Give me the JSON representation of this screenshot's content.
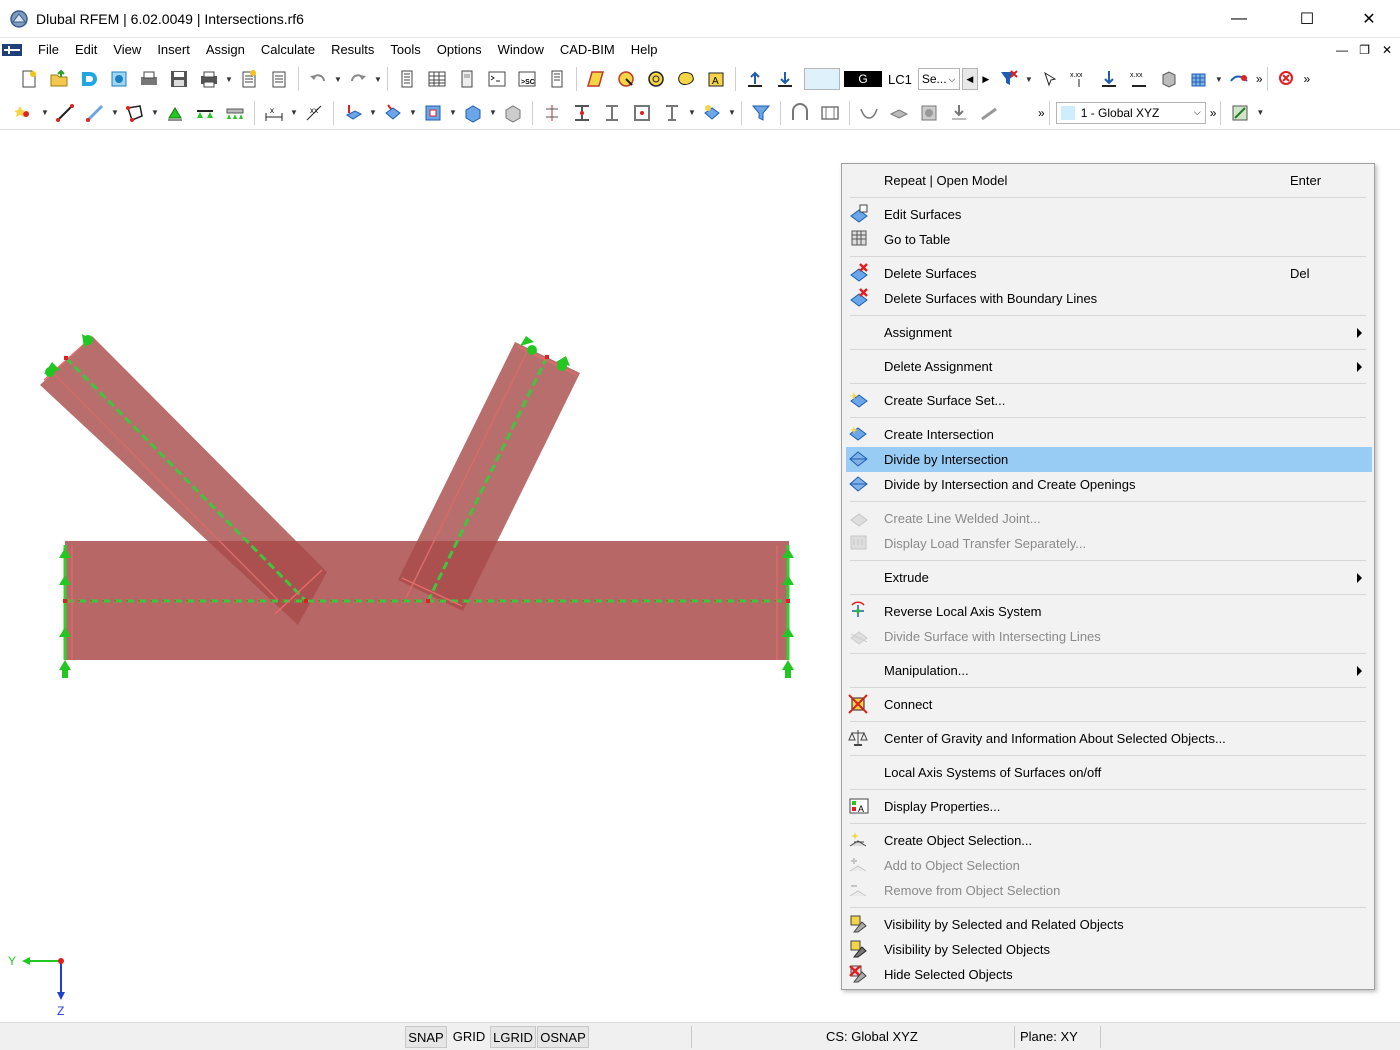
{
  "window": {
    "title": "Dlubal RFEM | 6.02.0049 | Intersections.rf6",
    "minimize_glyph": "—",
    "maximize_glyph": "☐",
    "close_glyph": "✕"
  },
  "menubar": {
    "items": [
      "File",
      "Edit",
      "View",
      "Insert",
      "Assign",
      "Calculate",
      "Results",
      "Tools",
      "Options",
      "Window",
      "CAD-BIM",
      "Help"
    ],
    "mdi_min": "—",
    "mdi_restore": "❐",
    "mdi_close": "✕"
  },
  "toolbar1": {
    "load_case_badge": "G",
    "load_case": "LC1",
    "load_case_select": "Se...",
    "overflow": "»"
  },
  "toolbar2": {
    "coordinate_system": "1 - Global XYZ",
    "overflow": "»"
  },
  "viewport": {
    "axis_y_label": "Y",
    "axis_z_label": "Z",
    "colors": {
      "surface_fill": "#b05656",
      "member_line": "#3ec63e",
      "support": "#22c722",
      "node": "#e02020"
    }
  },
  "context_menu": {
    "items": [
      {
        "label": "Repeat | Open Model",
        "shortcut": "Enter",
        "icon": "none",
        "disabled": false,
        "submenu": false,
        "highlight": false
      },
      {
        "label": "Edit Surfaces",
        "shortcut": "",
        "icon": "edit-surfaces-icon",
        "disabled": false,
        "submenu": false,
        "highlight": false
      },
      {
        "label": "Go to Table",
        "shortcut": "",
        "icon": "table-icon",
        "disabled": false,
        "submenu": false,
        "highlight": false
      },
      {
        "label": "Delete Surfaces",
        "shortcut": "Del",
        "icon": "delete-icon",
        "disabled": false,
        "submenu": false,
        "highlight": false
      },
      {
        "label": "Delete Surfaces with Boundary Lines",
        "shortcut": "",
        "icon": "delete-icon",
        "disabled": false,
        "submenu": false,
        "highlight": false
      },
      {
        "label": "Assignment",
        "shortcut": "",
        "icon": "none",
        "disabled": false,
        "submenu": true,
        "highlight": false
      },
      {
        "label": "Delete Assignment",
        "shortcut": "",
        "icon": "none",
        "disabled": false,
        "submenu": true,
        "highlight": false
      },
      {
        "label": "Create Surface Set...",
        "shortcut": "",
        "icon": "surface-set-icon",
        "disabled": false,
        "submenu": false,
        "highlight": false
      },
      {
        "label": "Create Intersection",
        "shortcut": "",
        "icon": "intersection-icon",
        "disabled": false,
        "submenu": false,
        "highlight": false
      },
      {
        "label": "Divide by Intersection",
        "shortcut": "",
        "icon": "divide-icon",
        "disabled": false,
        "submenu": false,
        "highlight": true
      },
      {
        "label": "Divide by Intersection and Create Openings",
        "shortcut": "",
        "icon": "divide-icon",
        "disabled": false,
        "submenu": false,
        "highlight": false
      },
      {
        "label": "Create Line Welded Joint...",
        "shortcut": "",
        "icon": "welded-joint-icon",
        "disabled": true,
        "submenu": false,
        "highlight": false
      },
      {
        "label": "Display Load Transfer Separately...",
        "shortcut": "",
        "icon": "load-transfer-icon",
        "disabled": true,
        "submenu": false,
        "highlight": false
      },
      {
        "label": "Extrude",
        "shortcut": "",
        "icon": "none",
        "disabled": false,
        "submenu": true,
        "highlight": false
      },
      {
        "label": "Reverse Local Axis System",
        "shortcut": "",
        "icon": "reverse-axis-icon",
        "disabled": false,
        "submenu": false,
        "highlight": false
      },
      {
        "label": "Divide Surface with Intersecting Lines",
        "shortcut": "",
        "icon": "divide-lines-icon",
        "disabled": true,
        "submenu": false,
        "highlight": false
      },
      {
        "label": "Manipulation...",
        "shortcut": "",
        "icon": "none",
        "disabled": false,
        "submenu": true,
        "highlight": false
      },
      {
        "label": "Connect",
        "shortcut": "",
        "icon": "connect-icon",
        "disabled": false,
        "submenu": false,
        "highlight": false
      },
      {
        "label": "Center of Gravity and Information About Selected Objects...",
        "shortcut": "",
        "icon": "scales-icon",
        "disabled": false,
        "submenu": false,
        "highlight": false
      },
      {
        "label": "Local Axis Systems of Surfaces on/off",
        "shortcut": "",
        "icon": "none",
        "disabled": false,
        "submenu": false,
        "highlight": false
      },
      {
        "label": "Display Properties...",
        "shortcut": "",
        "icon": "display-properties-icon",
        "disabled": false,
        "submenu": false,
        "highlight": false
      },
      {
        "label": "Create Object Selection...",
        "shortcut": "",
        "icon": "selection-icon",
        "disabled": false,
        "submenu": false,
        "highlight": false
      },
      {
        "label": "Add to Object Selection",
        "shortcut": "",
        "icon": "selection-add-icon",
        "disabled": true,
        "submenu": false,
        "highlight": false
      },
      {
        "label": "Remove from Object Selection",
        "shortcut": "",
        "icon": "selection-remove-icon",
        "disabled": true,
        "submenu": false,
        "highlight": false
      },
      {
        "label": "Visibility by Selected and Related Objects",
        "shortcut": "",
        "icon": "visibility-related-icon",
        "disabled": false,
        "submenu": false,
        "highlight": false
      },
      {
        "label": "Visibility by Selected Objects",
        "shortcut": "",
        "icon": "visibility-selected-icon",
        "disabled": false,
        "submenu": false,
        "highlight": false
      },
      {
        "label": "Hide Selected Objects",
        "shortcut": "",
        "icon": "hide-icon",
        "disabled": false,
        "submenu": false,
        "highlight": false
      }
    ]
  },
  "statusbar": {
    "snap": "SNAP",
    "grid": "GRID",
    "lgrid": "LGRID",
    "osnap": "OSNAP",
    "cs": "CS: Global XYZ",
    "plane": "Plane: XY"
  }
}
